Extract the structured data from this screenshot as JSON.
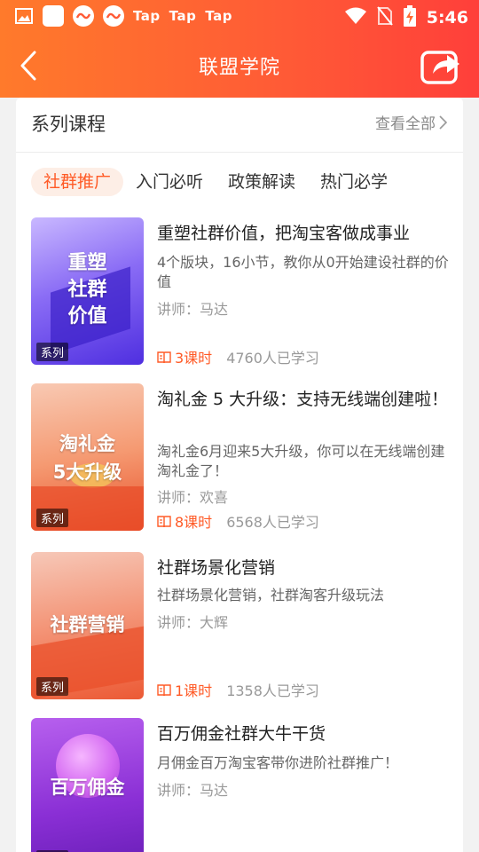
{
  "statusbar": {
    "tap_labels": [
      "Tap",
      "Tap",
      "Tap"
    ],
    "time": "5:46"
  },
  "navbar": {
    "title": "联盟学院"
  },
  "section": {
    "title": "系列课程",
    "view_all": "查看全部"
  },
  "tabs": [
    {
      "label": "社群推广",
      "active": true
    },
    {
      "label": "入门必听",
      "active": false
    },
    {
      "label": "政策解读",
      "active": false
    },
    {
      "label": "热门必学",
      "active": false
    }
  ],
  "courses": [
    {
      "thumb_text_1": "重塑",
      "thumb_text_2": "社群",
      "thumb_text_3": "价值",
      "badge": "系列",
      "title": "重塑社群价值，把淘宝客做成事业",
      "desc": "4个版块，16小节，教你从0开始建设社群的价值",
      "teacher": "讲师：马达",
      "lessons": "3课时",
      "learners": "4760人已学习",
      "thumb_color": "#6b47f0"
    },
    {
      "thumb_text_1": "淘礼金",
      "thumb_text_2": "5大升级",
      "badge": "系列",
      "title": "淘礼金 5 大升级：支持无线端创建啦！",
      "desc": "淘礼金6月迎来5大升级，你可以在无线端创建淘礼金了！",
      "teacher": "讲师：欢喜",
      "lessons": "8课时",
      "learners": "6568人已学习",
      "thumb_color": "#f06a3a"
    },
    {
      "thumb_text_1": "社群营销",
      "badge": "系列",
      "title": "社群场景化营销",
      "desc": "社群场景化营销，社群淘客升级玩法",
      "teacher": "讲师：大辉",
      "lessons": "1课时",
      "learners": "1358人已学习",
      "thumb_color": "#f2603a"
    },
    {
      "thumb_text_1": "百万佣金",
      "badge": "系列",
      "title": "百万佣金社群大牛干货",
      "desc": "月佣金百万淘宝客带你进阶社群推广！",
      "teacher": "讲师：马达",
      "thumb_color": "#a02fd8"
    }
  ]
}
